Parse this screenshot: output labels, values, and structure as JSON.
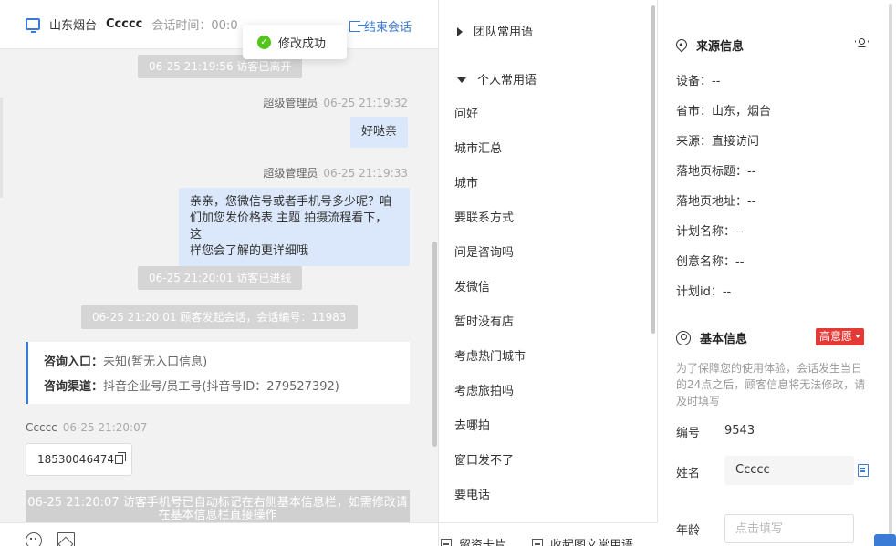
{
  "header": {
    "location": "山东烟台",
    "visitor_name": "Ccccc",
    "session_time": "会话时间：00:0",
    "hidden_action": "",
    "end_label": "结束会话"
  },
  "toast": {
    "text": "修改成功"
  },
  "chat": {
    "sys1": "06-25 21:19:56 访客已离开",
    "msg1": {
      "sender": "超级管理员",
      "time": "06-25 21:19:32",
      "text": "好哒亲"
    },
    "msg2": {
      "sender": "超级管理员",
      "time": "06-25 21:19:33",
      "line1": "亲亲，您微信号或者手机号多少呢？咱",
      "line2": "们加您发价格表 主题 拍摄流程看下，这",
      "line3": "样您会了解的更详细哦"
    },
    "sys2": "06-25 21:20:01 访客已进线",
    "sys3": "06-25 21:20:01 顾客发起会话，会话编号：11983",
    "entry": {
      "k": "咨询入口：",
      "v": "未知(暂无入口信息)"
    },
    "channel": {
      "k": "咨询渠道：",
      "v": "抖音企业号/员工号(抖音号ID：279527392)"
    },
    "msg3": {
      "sender": "Ccccc",
      "time": "06-25 21:20:07",
      "text": "18530046474"
    },
    "sys4_line1": "06-25 21:20:07 访客手机号已自动标记在右侧基本信息栏，如需修改请",
    "sys4_line2": "在基本信息栏直接操作"
  },
  "phrases": {
    "team_group": "团队常用语",
    "personal_group": "个人常用语",
    "items": [
      "问好",
      "城市汇总",
      "城市",
      "要联系方式",
      "问是咨询吗",
      "发微信",
      "暂时没有店",
      "考虑热门城市",
      "考虑旅拍吗",
      "去哪拍",
      "窗口发不了",
      "要电话"
    ],
    "card_btn": "留资卡片",
    "collapse_btn": "收起图文常用语"
  },
  "source": {
    "title": "来源信息",
    "device": "设备：--",
    "province": "省市：山东，烟台",
    "origin": "来源：直接访问",
    "landing_title": "落地页标题：--",
    "landing_url": "落地页地址：--",
    "plan_name": "计划名称：--",
    "creative_name": "创意名称：--",
    "plan_id": "计划id：--"
  },
  "basic": {
    "title": "基本信息",
    "intent_badge": "高意愿",
    "notice": "为了保障您的使用体验，会话发生当日的24点之后，顾客信息将无法修改，请及时填写",
    "id_label": "编号",
    "id_value": "9543",
    "name_label": "姓名",
    "name_value": "Ccccc",
    "age_label": "年龄",
    "age_placeholder": "点击填写"
  },
  "colors": {
    "accent": "#3a7bd5",
    "success": "#52c41a",
    "danger": "#e53935"
  }
}
